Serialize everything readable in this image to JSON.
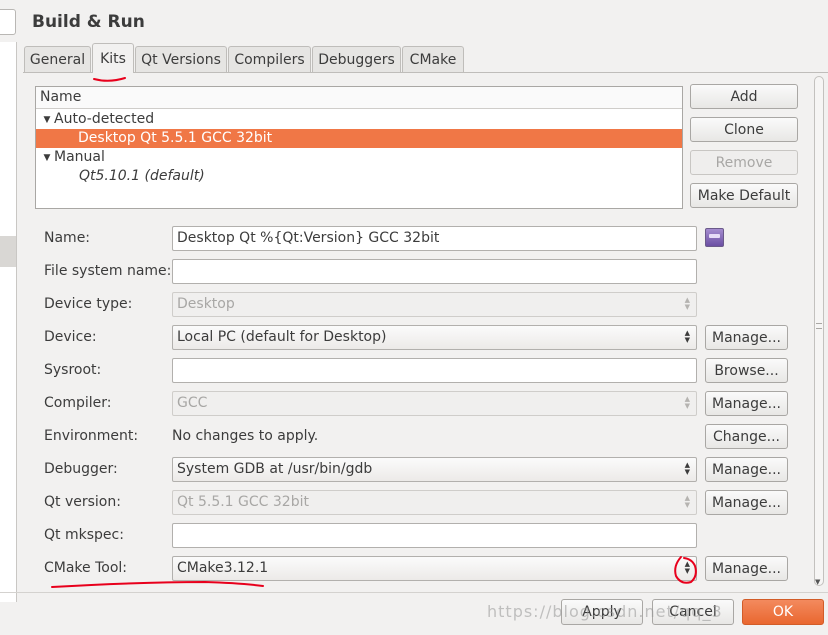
{
  "title": "Build & Run",
  "tabs": [
    "General",
    "Kits",
    "Qt Versions",
    "Compilers",
    "Debuggers",
    "CMake"
  ],
  "active_tab": "Kits",
  "kit_list": {
    "header": "Name",
    "groups": [
      {
        "label": "Auto-detected",
        "items": [
          "Desktop Qt 5.5.1 GCC 32bit"
        ]
      },
      {
        "label": "Manual",
        "items": [
          "Qt5.10.1 (default)"
        ]
      }
    ],
    "selected": "Desktop Qt 5.5.1 GCC 32bit"
  },
  "side_buttons": {
    "add": "Add",
    "clone": "Clone",
    "remove": "Remove",
    "make_default": "Make Default"
  },
  "form": {
    "name": {
      "label": "Name:",
      "value": "Desktop Qt %{Qt:Version} GCC 32bit"
    },
    "file_system_name": {
      "label": "File system name:",
      "value": ""
    },
    "device_type": {
      "label": "Device type:",
      "value": "Desktop"
    },
    "device": {
      "label": "Device:",
      "value": "Local PC (default for Desktop)",
      "button": "Manage..."
    },
    "sysroot": {
      "label": "Sysroot:",
      "value": "",
      "button": "Browse..."
    },
    "compiler": {
      "label": "Compiler:",
      "value": "GCC",
      "button": "Manage..."
    },
    "environment": {
      "label": "Environment:",
      "value": "No changes to apply.",
      "button": "Change..."
    },
    "debugger": {
      "label": "Debugger:",
      "value": "System GDB at /usr/bin/gdb",
      "button": "Manage..."
    },
    "qt_version": {
      "label": "Qt version:",
      "value": "Qt 5.5.1 GCC 32bit",
      "button": "Manage..."
    },
    "qt_mkspec": {
      "label": "Qt mkspec:",
      "value": ""
    },
    "cmake_tool": {
      "label": "CMake Tool:",
      "value": "CMake3.12.1",
      "button": "Manage..."
    }
  },
  "dialog_buttons": {
    "apply": "Apply",
    "cancel": "Cancel",
    "ok": "OK"
  },
  "watermark": "https://blog.csdn.net/qq_3",
  "colors": {
    "accent": "#f07746",
    "annotation": "#e8001c"
  }
}
